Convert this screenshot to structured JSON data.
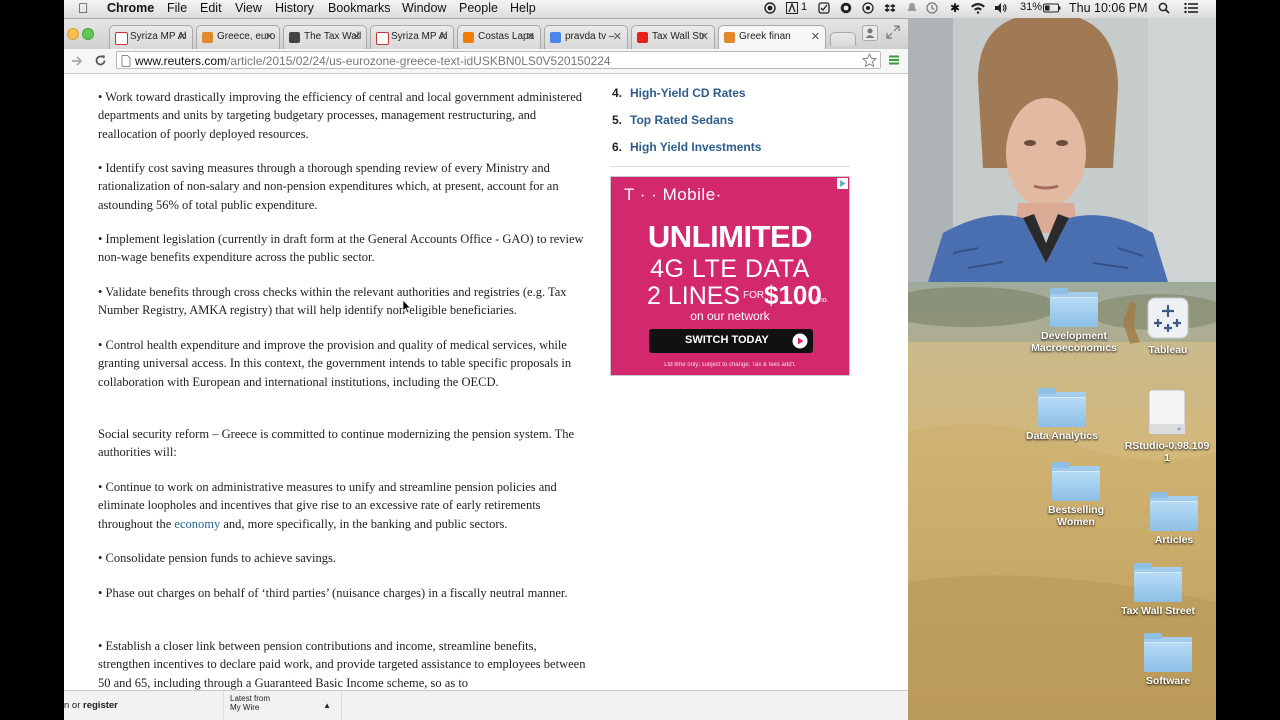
{
  "menubar": {
    "app": "Chrome",
    "items": [
      "File",
      "Edit",
      "View",
      "History",
      "Bookmarks",
      "Window",
      "People",
      "Help"
    ],
    "status_text": "1",
    "battery": "31%",
    "clock": "Thu 10:06 PM"
  },
  "tabs": [
    {
      "title": "Syriza MP Al",
      "fav": "#cc3333"
    },
    {
      "title": "Greece, euro",
      "fav": "#e08a2c"
    },
    {
      "title": "The Tax Wall",
      "fav": "#444444"
    },
    {
      "title": "Syriza MP Al",
      "fav": "#cc3333"
    },
    {
      "title": "Costas Lapa",
      "fav": "#f07c00"
    },
    {
      "title": "pravda tv –",
      "fav": "#4a86e8"
    },
    {
      "title": "Tax Wall Str",
      "fav": "#e62117"
    },
    {
      "title": "Greek finan",
      "fav": "#e08a2c"
    }
  ],
  "address": {
    "host": "www.reuters.com",
    "path": "/article/2015/02/24/us-eurozone-greece-text-idUSKBN0LS0V520150224"
  },
  "article": [
    "• Work toward drastically improving the efficiency of central and local government administered departments and units by targeting budgetary processes, management restructuring, and reallocation of poorly deployed resources.",
    "• Identify cost saving measures through a thorough spending review of every Ministry and rationalization of non-salary and non-pension expenditures which, at present, account for an astounding 56% of total public expenditure.",
    "• Implement legislation (currently in draft form at the General Accounts Office - GAO) to review non-wage benefits expenditure across the public sector.",
    "• Validate benefits through cross checks within the relevant authorities and registries (e.g. Tax Number Registry, AMKA registry) that will help identify non-eligible beneficiaries.",
    "• Control health expenditure and improve the provision and quality of medical services, while granting universal access. In this context, the government intends to table specific proposals in collaboration with European and international institutions, including the OECD.",
    "Social security reform – Greece is committed to continue modernizing the pension system. The authorities will:",
    {
      "before": "• Continue to work on administrative measures to unify and streamline pension policies and eliminate loopholes and incentives that give rise to an excessive rate of early retirements throughout the ",
      "link": "economy",
      "after": " and, more specifically, in the banking and public sectors."
    },
    "• Consolidate pension funds to achieve savings.",
    "• Phase out charges on behalf of ‘third parties’ (nuisance charges) in a fiscally neutral manner.",
    "• Establish a closer link between pension contributions and income, streamline benefits, strengthen incentives to declare paid work, and provide targeted assistance to employees between 50 and 65, including through a Guaranteed Basic Income scheme, so as to"
  ],
  "popular": [
    {
      "num": "4.",
      "label": "High-Yield CD Rates"
    },
    {
      "num": "5.",
      "label": "Top Rated Sedans"
    },
    {
      "num": "6.",
      "label": "High Yield Investments"
    }
  ],
  "ad": {
    "brand": "T · · Mobile·",
    "headline": "UNLIMITED",
    "line2": "4G LTE DATA",
    "line3a": "2 LINES",
    "for": "FOR",
    "price": "$100",
    "per": "/mo.",
    "network": "on our network",
    "cta": "SWITCH TODAY",
    "disclaimer": "Ltd time only; subject to change. Tax & fees add'l."
  },
  "statusbar": {
    "signin_a": "n or ",
    "register": "register",
    "latest_line1": "Latest from",
    "latest_line2": "My Wire"
  },
  "desktop_icons": [
    {
      "label": "Development Macroeconomics",
      "kind": "folder"
    },
    {
      "label": "Tableau",
      "kind": "app"
    },
    {
      "label": "Data Analytics",
      "kind": "folder"
    },
    {
      "label": "RStudio-0.98.1091",
      "kind": "disk"
    },
    {
      "label": "Bestselling Women",
      "kind": "folder"
    },
    {
      "label": "Articles",
      "kind": "folder"
    },
    {
      "label": "Tax Wall Street",
      "kind": "folder"
    },
    {
      "label": "Software",
      "kind": "folder"
    }
  ]
}
